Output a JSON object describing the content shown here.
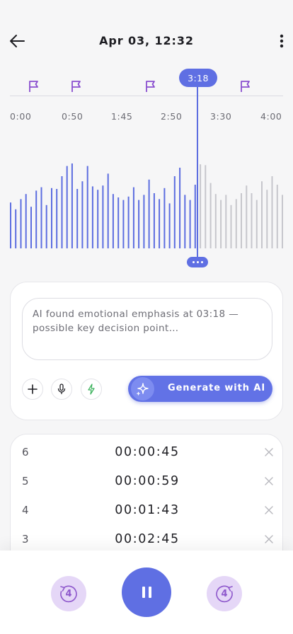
{
  "header": {
    "title": "Apr 03, 12:32"
  },
  "timeline": {
    "ticks": [
      "0:00",
      "0:50",
      "1:45",
      "2:50",
      "3:30",
      "4:00"
    ],
    "flags": [
      "flag-1",
      "flag-2",
      "flag-3",
      "flag-4",
      "flag-5"
    ],
    "playhead_label": "3:18",
    "played_color": "#5c6de0",
    "unplayed_color": "#c6c6cc",
    "waveform_levels": [
      0.54,
      0.46,
      0.58,
      0.64,
      0.49,
      0.68,
      0.72,
      0.51,
      0.71,
      0.7,
      0.85,
      0.97,
      1.0,
      0.7,
      0.79,
      0.97,
      0.73,
      0.69,
      0.74,
      0.88,
      0.64,
      0.6,
      0.57,
      0.61,
      0.72,
      0.57,
      0.63,
      0.81,
      0.65,
      0.58,
      0.71,
      0.53,
      0.85,
      0.95,
      0.63,
      0.57,
      0.75,
      0.99,
      0.98,
      0.77,
      0.64,
      0.57,
      0.63,
      0.51,
      0.58,
      0.65,
      0.74,
      0.65,
      0.57,
      0.79,
      0.69,
      0.85,
      0.75,
      0.63
    ]
  },
  "ai_panel": {
    "message": "AI found emotional emphasis at 03:18 — possible key decision point…",
    "generate_label": "Generate with AI"
  },
  "laps": [
    {
      "num": "6",
      "time": "00:00:45"
    },
    {
      "num": "5",
      "time": "00:00:59"
    },
    {
      "num": "4",
      "time": "00:01:43"
    },
    {
      "num": "3",
      "time": "00:02:45"
    }
  ],
  "player": {
    "skip_back_seconds": "4",
    "skip_forward_seconds": "4"
  }
}
